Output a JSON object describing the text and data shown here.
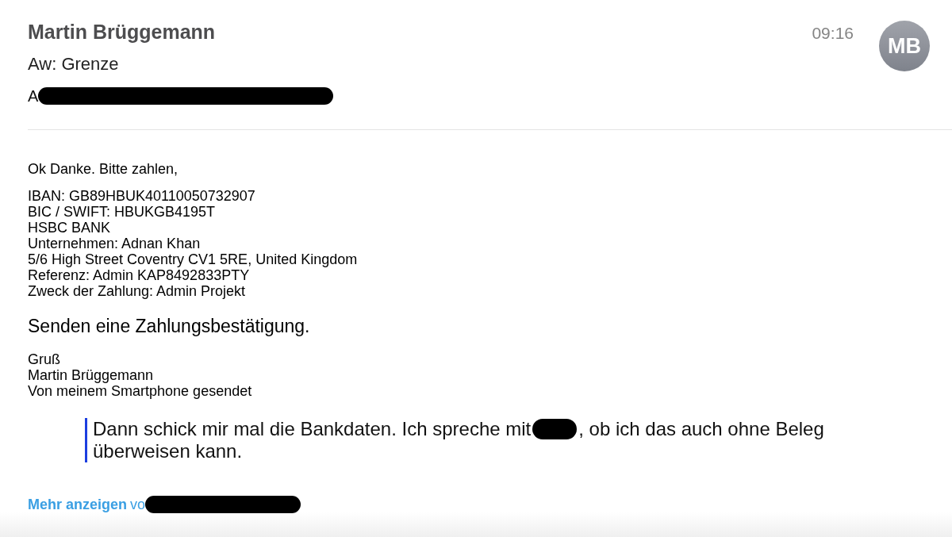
{
  "message": {
    "sender": "Martin Brüggemann",
    "subject": "Aw: Grenze",
    "recipient": [
      {
        "kind": "text",
        "text": "A"
      },
      {
        "kind": "redaction"
      }
    ],
    "time": "09:16",
    "avatar": {
      "initials": "MB"
    }
  },
  "body": [
    {
      "kind": "paragraph",
      "lines": [
        "Ok Danke. Bitte zahlen,"
      ]
    },
    {
      "kind": "paragraph",
      "lines": [
        "IBAN: GB89HBUK40110050732907",
        "BIC / SWIFT: HBUKGB4195T",
        "HSBC BANK",
        "Unternehmen: Adnan Khan",
        "5/6 High Street Coventry CV1 5RE, United Kingdom",
        "Referenz: Admin KAP8492833PTY",
        "Zweck der Zahlung: Admin Projekt"
      ]
    },
    {
      "kind": "emphasis",
      "lines": [
        "Senden eine Zahlungsbestätigung."
      ]
    },
    {
      "kind": "paragraph",
      "lines": [
        "Gruß",
        "Martin Brüggemann",
        "Von meinem Smartphone gesendet"
      ]
    }
  ],
  "quote": {
    "lines": [
      {
        "parts": [
          {
            "kind": "text",
            "text": "Dann schick mir mal die Bankdaten. Ich spreche mit"
          },
          {
            "kind": "redaction"
          },
          {
            "kind": "text",
            "text": ", ob ich das auch ohne Beleg"
          }
        ]
      },
      {
        "parts": [
          {
            "kind": "text",
            "text": "überweisen kann."
          }
        ]
      }
    ]
  },
  "footer": [
    {
      "kind": "link",
      "text": "Mehr anzeigen"
    },
    {
      "kind": "text",
      "text": "vo"
    },
    {
      "kind": "redaction"
    }
  ]
}
